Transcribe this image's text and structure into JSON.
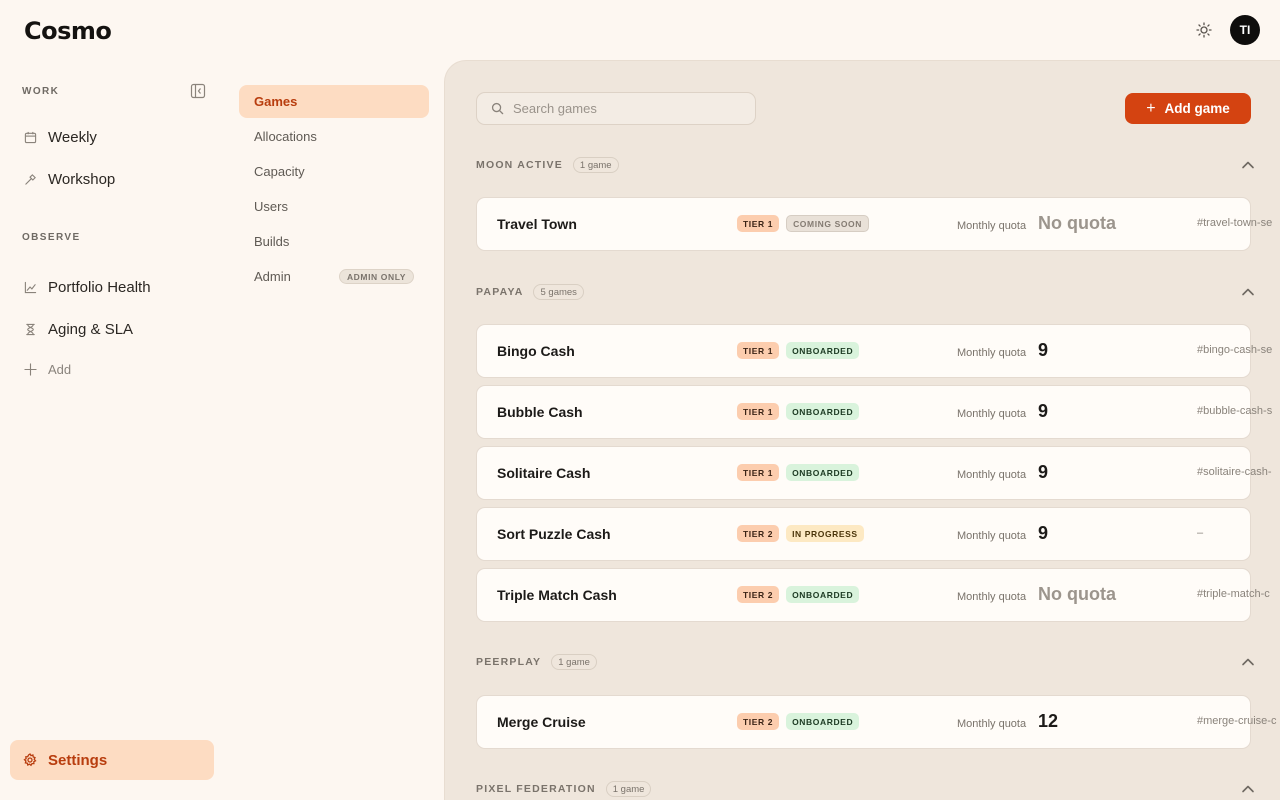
{
  "app": {
    "logo": "Cosmo",
    "avatar_initials": "TI"
  },
  "sidebar": {
    "work_label": "WORK",
    "observe_label": "OBSERVE",
    "work_items": [
      {
        "label": "Weekly",
        "icon": "calendar-icon"
      },
      {
        "label": "Workshop",
        "icon": "hammer-icon"
      }
    ],
    "observe_items": [
      {
        "label": "Portfolio Health",
        "icon": "line-chart-icon"
      },
      {
        "label": "Aging & SLA",
        "icon": "hourglass-icon"
      }
    ],
    "add_label": "Add",
    "settings_label": "Settings"
  },
  "settings_nav": {
    "items": [
      {
        "label": "Games",
        "active": true
      },
      {
        "label": "Allocations"
      },
      {
        "label": "Capacity"
      },
      {
        "label": "Users"
      },
      {
        "label": "Builds"
      },
      {
        "label": "Admin",
        "badge": "ADMIN ONLY"
      }
    ]
  },
  "toolbar": {
    "search_placeholder": "Search games",
    "add_label": "Add game"
  },
  "groups": [
    {
      "name": "MOON ACTIVE",
      "count": "1 game",
      "games": [
        {
          "name": "Travel Town",
          "tier": "TIER 1",
          "status": "COMING SOON",
          "quota_label": "Monthly quota",
          "quota": "No quota",
          "channel": "#travel-town-se"
        }
      ]
    },
    {
      "name": "PAPAYA",
      "count": "5 games",
      "games": [
        {
          "name": "Bingo Cash",
          "tier": "TIER 1",
          "status": "ONBOARDED",
          "quota_label": "Monthly quota",
          "quota": "9",
          "channel": "#bingo-cash-se"
        },
        {
          "name": "Bubble Cash",
          "tier": "TIER 1",
          "status": "ONBOARDED",
          "quota_label": "Monthly quota",
          "quota": "9",
          "channel": "#bubble-cash-s"
        },
        {
          "name": "Solitaire Cash",
          "tier": "TIER 1",
          "status": "ONBOARDED",
          "quota_label": "Monthly quota",
          "quota": "9",
          "channel": "#solitaire-cash-"
        },
        {
          "name": "Sort Puzzle Cash",
          "tier": "TIER 2",
          "status": "IN PROGRESS",
          "quota_label": "Monthly quota",
          "quota": "9",
          "channel": "–"
        },
        {
          "name": "Triple Match Cash",
          "tier": "TIER 2",
          "status": "ONBOARDED",
          "quota_label": "Monthly quota",
          "quota": "No quota",
          "channel": "#triple-match-c"
        }
      ]
    },
    {
      "name": "PEERPLAY",
      "count": "1 game",
      "games": [
        {
          "name": "Merge Cruise",
          "tier": "TIER 2",
          "status": "ONBOARDED",
          "quota_label": "Monthly quota",
          "quota": "12",
          "channel": "#merge-cruise-c"
        }
      ]
    },
    {
      "name": "PIXEL FEDERATION",
      "count": "1 game",
      "games": []
    }
  ],
  "colors": {
    "accent": "#d44311",
    "active_bg": "#fddcc2",
    "onboarded": "#d9f3dc",
    "in_progress": "#fde9c3",
    "coming_soon": "#e9e1d8",
    "tier": "#fccdae"
  }
}
